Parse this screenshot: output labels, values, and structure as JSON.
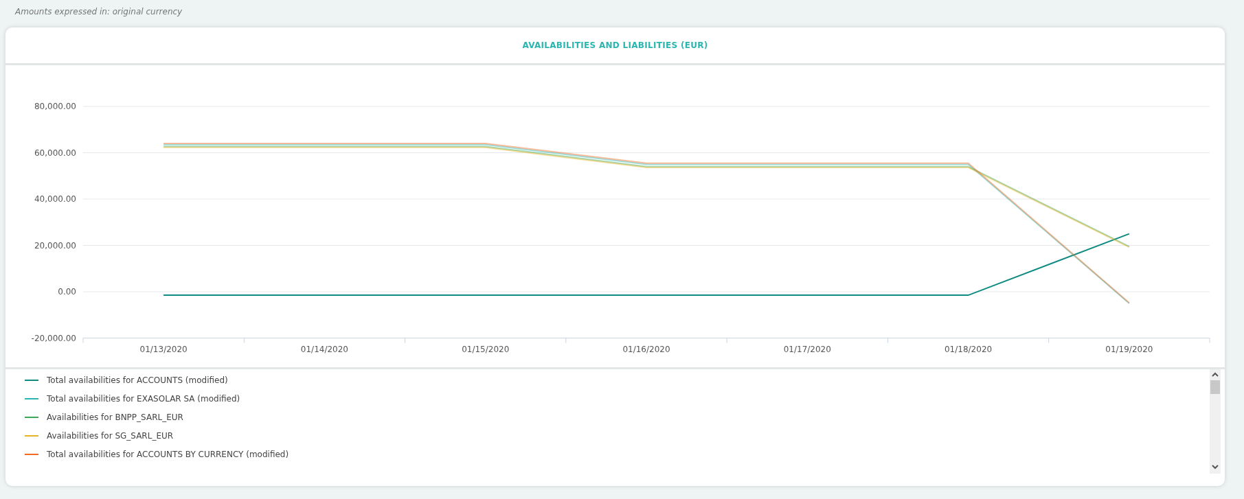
{
  "caption": "Amounts expressed in: original currency",
  "card": {
    "title": "AVAILABILITIES AND LIABILITIES (EUR)",
    "chart_data": {
      "type": "line",
      "categories": [
        "01/13/2020",
        "01/14/2020",
        "01/15/2020",
        "01/16/2020",
        "01/17/2020",
        "01/18/2020",
        "01/19/2020"
      ],
      "yticks": [
        {
          "value": -20000,
          "label": "-20,000.00"
        },
        {
          "value": 0,
          "label": "0.00"
        },
        {
          "value": 20000,
          "label": "20,000.00"
        },
        {
          "value": 40000,
          "label": "40,000.00"
        },
        {
          "value": 60000,
          "label": "60,000.00"
        },
        {
          "value": 80000,
          "label": "80,000.00"
        }
      ],
      "ylim": [
        -20000,
        80000
      ],
      "grid": true,
      "series": [
        {
          "name": "Total availabilities for ACCOUNTS (modified)",
          "color": "#0f8a80",
          "values": [
            -1500,
            -1500,
            -1500,
            -1500,
            -1500,
            -1500,
            25000
          ]
        },
        {
          "name": "Total availabilities for EXASOLAR SA (modified)",
          "color": "#2bb3b0",
          "values": [
            63500,
            63500,
            63500,
            55000,
            55000,
            55000,
            -5000
          ]
        },
        {
          "name": "Availabilities for BNPP_SARL_EUR",
          "color": "#3aa757",
          "values": [
            62700,
            62700,
            62700,
            54000,
            54000,
            54000,
            19500
          ]
        },
        {
          "name": "Availabilities for SG_SARL_EUR",
          "color": "#e6b422",
          "values": [
            62300,
            62300,
            62300,
            53600,
            53600,
            53600,
            19200
          ]
        },
        {
          "name": "Total availabilities for ACCOUNTS BY CURRENCY (modified)",
          "color": "#f26b21",
          "values": [
            64000,
            64000,
            64000,
            55500,
            55500,
            55500,
            -4800
          ]
        }
      ]
    }
  }
}
